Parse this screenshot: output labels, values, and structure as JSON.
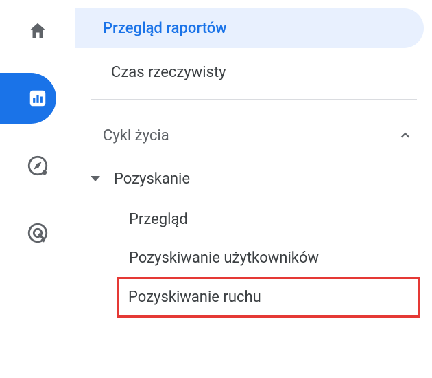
{
  "rail": {
    "items": [
      {
        "name": "home-icon"
      },
      {
        "name": "reports-icon",
        "active": true
      },
      {
        "name": "explore-icon"
      },
      {
        "name": "advertising-icon"
      }
    ]
  },
  "panel": {
    "topItems": [
      {
        "label": "Przegląd raportów",
        "selected": true
      },
      {
        "label": "Czas rzeczywisty",
        "selected": false
      }
    ],
    "section": {
      "title": "Cykl życia",
      "expanded": true,
      "group": {
        "label": "Pozyskanie",
        "expanded": true,
        "children": [
          {
            "label": "Przegląd"
          },
          {
            "label": "Pozyskiwanie użytkowników"
          },
          {
            "label": "Pozyskiwanie ruchu",
            "highlighted": true
          }
        ]
      }
    }
  }
}
